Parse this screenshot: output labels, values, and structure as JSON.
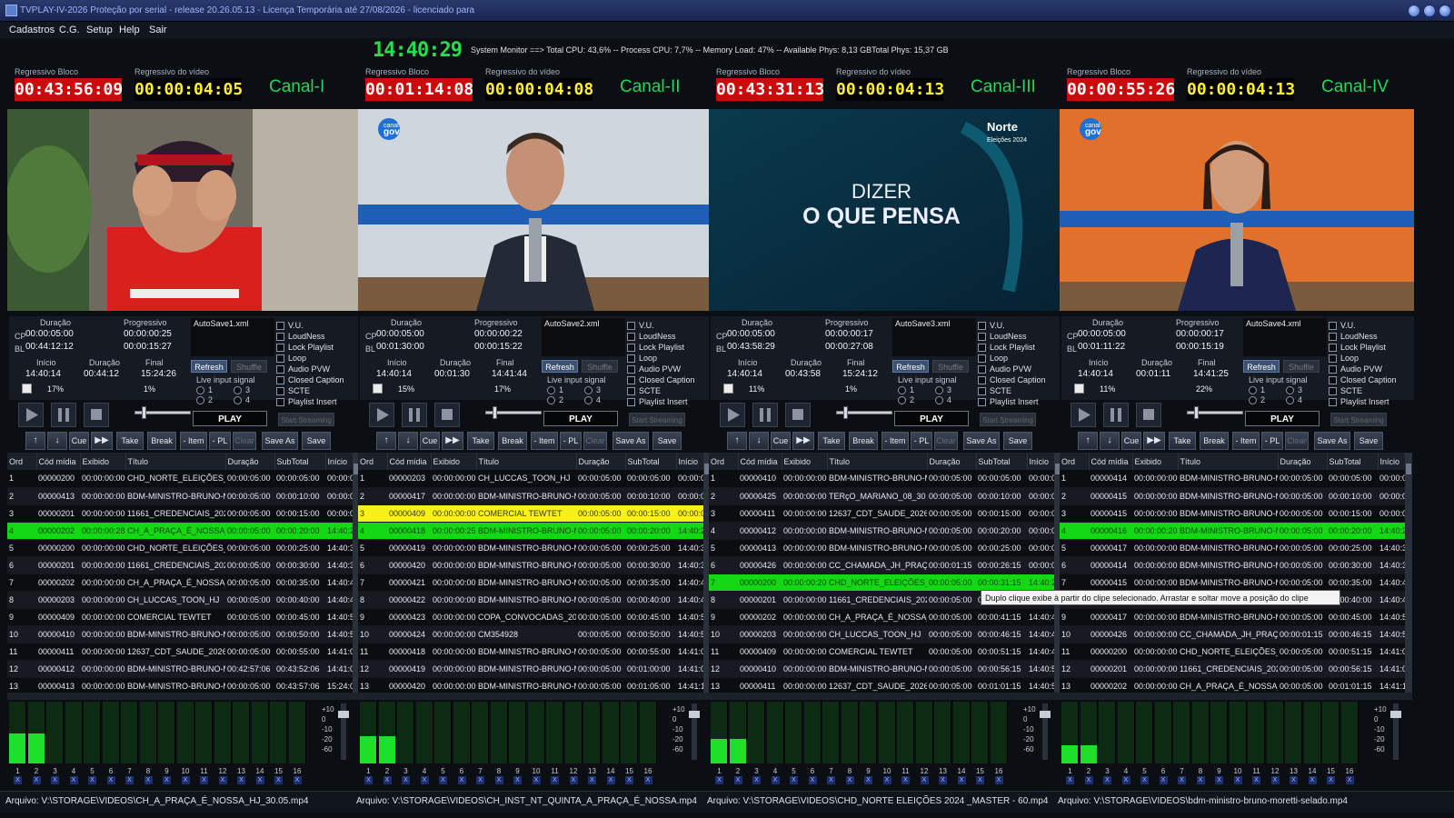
{
  "window": {
    "title": "TVPLAY-IV-2026  Proteção por serial   -  release 20.26.05.13 - Licença  Temporária até 27/08/2026 - licenciado para"
  },
  "menu": [
    "Cadastros",
    "C.G.",
    "Setup",
    "Help",
    "Sair"
  ],
  "clock": "14:40:29",
  "system_monitor": "System Monitor ==> Total CPU: 43,6% -- Process CPU: 7,7% -- Memory Load: 47% -- Available Phys: 8,13 GBTotal  Phys: 15,37 GB",
  "labels": {
    "reg_bloco": "Regressivo Bloco",
    "reg_video": "Regressivo do vídeo",
    "duracao": "Duração",
    "progressivo": "Progressivo",
    "inicio": "Início",
    "final": "Final",
    "cp": "CP",
    "bl": "BL",
    "live": "Live input signal",
    "refresh": "Refresh",
    "shuffle": "Shuffle",
    "play": "PLAY",
    "stream": "Start Streaming"
  },
  "checkboxes": [
    "V.U.",
    "LoudNess",
    "Lock Playlist",
    "Loop",
    "Audio PVW",
    "Closed Caption",
    "SCTE",
    "Playlist Insert"
  ],
  "radios": [
    "1",
    "3",
    "2",
    "4"
  ],
  "buttons": {
    "cue": "Cue",
    "take": "Take",
    "break": "Break",
    "item": "- Item",
    "pl": "- PL",
    "clear": "Clear",
    "saveas": "Save As",
    "save": "Save"
  },
  "table_headers": [
    "Ord",
    "Cód mídia",
    "Exibido",
    "Título",
    "Duração",
    "SubTotal",
    "Início"
  ],
  "meters": {
    "db": [
      "+10",
      "0",
      "-10",
      "-20",
      "-60"
    ],
    "numbers": [
      "1",
      "2",
      "3",
      "4",
      "5",
      "6",
      "7",
      "8",
      "9",
      "10",
      "11",
      "12",
      "13",
      "14",
      "15",
      "16"
    ],
    "mute": "X"
  },
  "tooltip": "Duplo clique exibe à partir do clipe selecionado. Arrastar e soltar move a posição do clipe",
  "preview3": {
    "line1": "DIZER",
    "line2": "O QUE PENSA",
    "logo": "Norte",
    "logo_sub": "Eleições 2024"
  },
  "preview_logo": "gov",
  "preview_logo_small": "canal",
  "channels": [
    {
      "name": "Canal-I",
      "reg_bloco": "00:43:56:09",
      "reg_video": "00:00:04:05",
      "cp_dur": "00:00:05:00",
      "bl_dur": "00:44:12:12",
      "cp_prog": "00:00:00:25",
      "bl_prog": "00:00:15:27",
      "inicio": "14:40:14",
      "duracao": "00:44:12",
      "final": "15:24:26",
      "pct1": "17%",
      "pct2": "1%",
      "file": "AutoSave1.xml",
      "arquivo": "Arquivo: V:\\STORAGE\\VIDEOS\\CH_A_PRAÇA_É_NOSSA_HJ_30.05.mp4",
      "meter": [
        0.48,
        0.48,
        0,
        0,
        0,
        0,
        0,
        0,
        0,
        0,
        0,
        0,
        0,
        0,
        0,
        0
      ],
      "rows": [
        [
          "1",
          "00000200",
          "00:00:00:00",
          "CHD_NORTE_ELEIÇÕES_2024",
          "00:00:05:00",
          "00:00:05:00",
          "00:00:0"
        ],
        [
          "2",
          "00000413",
          "00:00:00:00",
          "BDM-MINISTRO-BRUNO-MORETTI",
          "00:00:05:00",
          "00:00:10:00",
          "00:00:0"
        ],
        [
          "3",
          "00000201",
          "00:00:00:00",
          "11661_CREDENCIAIS_2026",
          "00:00:05:00",
          "00:00:15:00",
          "00:00:0"
        ],
        [
          "4",
          "00000202",
          "00:00:00:28",
          "CH_A_PRAÇA_É_NOSSA_HJ",
          "00:00:05:00",
          "00:00:20:00",
          "14:40:2"
        ],
        [
          "5",
          "00000200",
          "00:00:00:00",
          "CHD_NORTE_ELEIÇÕES_2024",
          "00:00:05:00",
          "00:00:25:00",
          "14:40:3"
        ],
        [
          "6",
          "00000201",
          "00:00:00:00",
          "11661_CREDENCIAIS_2026",
          "00:00:05:00",
          "00:00:30:00",
          "14:40:3"
        ],
        [
          "7",
          "00000202",
          "00:00:00:00",
          "CH_A_PRAÇA_É_NOSSA_HJ",
          "00:00:05:00",
          "00:00:35:00",
          "14:40:4"
        ],
        [
          "8",
          "00000203",
          "00:00:00:00",
          "CH_LUCCAS_TOON_HJ",
          "00:00:05:00",
          "00:00:40:00",
          "14:40:4"
        ],
        [
          "9",
          "00000409",
          "00:00:00:00",
          "COMERCIAL TEWTET",
          "00:00:05:00",
          "00:00:45:00",
          "14:40:5"
        ],
        [
          "10",
          "00000410",
          "00:00:00:00",
          "BDM-MINISTRO-BRUNO-MORETTI",
          "00:00:05:00",
          "00:00:50:00",
          "14:40:5"
        ],
        [
          "11",
          "00000411",
          "00:00:00:00",
          "12637_CDT_SAUDE_2026",
          "00:00:05:00",
          "00:00:55:00",
          "14:41:0"
        ],
        [
          "12",
          "00000412",
          "00:00:00:00",
          "BDM-MINISTRO-BRUNO-MORETTI",
          "00:42:57:06",
          "00:43:52:06",
          "14:41:0"
        ],
        [
          "13",
          "00000413",
          "00:00:00:00",
          "BDM-MINISTRO-BRUNO-MORETTI",
          "00:00:05:00",
          "00:43:57:06",
          "15:24:0"
        ]
      ]
    },
    {
      "name": "Canal-II",
      "reg_bloco": "00:01:14:08",
      "reg_video": "00:00:04:08",
      "cp_dur": "00:00:05:00",
      "bl_dur": "00:01:30:00",
      "cp_prog": "00:00:00:22",
      "bl_prog": "00:00:15:22",
      "inicio": "14:40:14",
      "duracao": "00:01:30",
      "final": "14:41:44",
      "pct1": "15%",
      "pct2": "17%",
      "file": "AutoSave2.xml",
      "arquivo": "Arquivo: V:\\STORAGE\\VIDEOS\\CH_INST_NT_QUINTA_A_PRAÇA_É_NOSSA.mp4",
      "meter": [
        0.44,
        0.44,
        0,
        0,
        0,
        0,
        0,
        0,
        0,
        0,
        0,
        0,
        0,
        0,
        0,
        0
      ],
      "rows": [
        [
          "1",
          "00000203",
          "00:00:00:00",
          "CH_LUCCAS_TOON_HJ",
          "00:00:05:00",
          "00:00:05:00",
          "00:00:0"
        ],
        [
          "2",
          "00000417",
          "00:00:00:00",
          "BDM-MINISTRO-BRUNO-MORETTI",
          "00:00:05:00",
          "00:00:10:00",
          "00:00:0"
        ],
        [
          "3",
          "00000409",
          "00:00:00:00",
          "COMERCIAL TEWTET",
          "00:00:05:00",
          "00:00:15:00",
          "00:00:0"
        ],
        [
          "4",
          "00000418",
          "00:00:00:25",
          "BDM-MINISTRO-BRUNO-MORETTI",
          "00:00:05:00",
          "00:00:20:00",
          "14:40:2"
        ],
        [
          "5",
          "00000419",
          "00:00:00:00",
          "BDM-MINISTRO-BRUNO-MORETTI",
          "00:00:05:00",
          "00:00:25:00",
          "14:40:3"
        ],
        [
          "6",
          "00000420",
          "00:00:00:00",
          "BDM-MINISTRO-BRUNO-MORETTI",
          "00:00:05:00",
          "00:00:30:00",
          "14:40:3"
        ],
        [
          "7",
          "00000421",
          "00:00:00:00",
          "BDM-MINISTRO-BRUNO-MORETTI",
          "00:00:05:00",
          "00:00:35:00",
          "14:40:4"
        ],
        [
          "8",
          "00000422",
          "00:00:00:00",
          "BDM-MINISTRO-BRUNO-MORETTI",
          "00:00:05:00",
          "00:00:40:00",
          "14:40:4"
        ],
        [
          "9",
          "00000423",
          "00:00:00:00",
          "COPA_CONVOCADAS_2026",
          "00:00:05:00",
          "00:00:45:00",
          "14:40:5"
        ],
        [
          "10",
          "00000424",
          "00:00:00:00",
          "CM354928",
          "00:00:05:00",
          "00:00:50:00",
          "14:40:5"
        ],
        [
          "11",
          "00000418",
          "00:00:00:00",
          "BDM-MINISTRO-BRUNO-MORETTI",
          "00:00:05:00",
          "00:00:55:00",
          "14:41:0"
        ],
        [
          "12",
          "00000419",
          "00:00:00:00",
          "BDM-MINISTRO-BRUNO-MORETTI",
          "00:00:05:00",
          "00:01:00:00",
          "14:41:0"
        ],
        [
          "13",
          "00000420",
          "00:00:00:00",
          "BDM-MINISTRO-BRUNO-MORETTI",
          "00:00:05:00",
          "00:01:05:00",
          "14:41:1"
        ]
      ]
    },
    {
      "name": "Canal-III",
      "reg_bloco": "00:43:31:13",
      "reg_video": "00:00:04:13",
      "cp_dur": "00:00:05:00",
      "bl_dur": "00:43:58:29",
      "cp_prog": "00:00:00:17",
      "bl_prog": "00:00:27:08",
      "inicio": "14:40:14",
      "duracao": "00:43:58",
      "final": "15:24:12",
      "pct1": "11%",
      "pct2": "1%",
      "file": "AutoSave3.xml",
      "arquivo": "Arquivo: V:\\STORAGE\\VIDEOS\\CHD_NORTE ELEIÇÕES 2024 _MASTER - 60.mp4",
      "meter": [
        0.4,
        0.4,
        0,
        0,
        0,
        0,
        0,
        0,
        0,
        0,
        0,
        0,
        0,
        0,
        0,
        0
      ],
      "rows": [
        [
          "1",
          "00000410",
          "00:00:00:00",
          "BDM-MINISTRO-BRUNO-MORETTI",
          "00:00:05:00",
          "00:00:05:00",
          "00:00:0"
        ],
        [
          "2",
          "00000425",
          "00:00:00:00",
          "TERçO_MARIANO_08_30",
          "00:00:05:00",
          "00:00:10:00",
          "00:00:0"
        ],
        [
          "3",
          "00000411",
          "00:00:00:00",
          "12637_CDT_SAUDE_2026",
          "00:00:05:00",
          "00:00:15:00",
          "00:00:0"
        ],
        [
          "4",
          "00000412",
          "00:00:00:00",
          "BDM-MINISTRO-BRUNO-MORETTI",
          "00:00:05:00",
          "00:00:20:00",
          "00:00:0"
        ],
        [
          "5",
          "00000413",
          "00:00:00:00",
          "BDM-MINISTRO-BRUNO-MORETTI",
          "00:00:05:00",
          "00:00:25:00",
          "00:00:0"
        ],
        [
          "6",
          "00000426",
          "00:00:00:00",
          "CC_CHAMADA_JH_PRAÇA",
          "00:00:01:15",
          "00:00:26:15",
          "00:00:0"
        ],
        [
          "7",
          "00000200",
          "00:00:00:20",
          "CHD_NORTE_ELEIÇÕES_2024",
          "00:00:05:00",
          "00:00:31:15",
          "14:40:2"
        ],
        [
          "8",
          "00000201",
          "00:00:00:00",
          "11661_CREDENCIAIS_2026",
          "00:00:05:00",
          "00:00:36:15",
          "14:40:3"
        ],
        [
          "9",
          "00000202",
          "00:00:00:00",
          "CH_A_PRAÇA_É_NOSSA_HJ",
          "00:00:05:00",
          "00:00:41:15",
          "14:40:4"
        ],
        [
          "10",
          "00000203",
          "00:00:00:00",
          "CH_LUCCAS_TOON_HJ",
          "00:00:05:00",
          "00:00:46:15",
          "14:40:4"
        ],
        [
          "11",
          "00000409",
          "00:00:00:00",
          "COMERCIAL TEWTET",
          "00:00:05:00",
          "00:00:51:15",
          "14:40:4"
        ],
        [
          "12",
          "00000410",
          "00:00:00:00",
          "BDM-MINISTRO-BRUNO-MORETTI",
          "00:00:05:00",
          "00:00:56:15",
          "14:40:5"
        ],
        [
          "13",
          "00000411",
          "00:00:00:00",
          "12637_CDT_SAUDE_2026",
          "00:00:05:00",
          "00:01:01:15",
          "14:40:5"
        ]
      ]
    },
    {
      "name": "Canal-IV",
      "reg_bloco": "00:00:55:26",
      "reg_video": "00:00:04:13",
      "cp_dur": "00:00:05:00",
      "bl_dur": "00:01:11:22",
      "cp_prog": "00:00:00:17",
      "bl_prog": "00:00:15:19",
      "inicio": "14:40:14",
      "duracao": "00:01:11",
      "final": "14:41:25",
      "pct1": "11%",
      "pct2": "22%",
      "file": "AutoSave4.xml",
      "arquivo": "Arquivo: V:\\STORAGE\\VIDEOS\\bdm-ministro-bruno-moretti-selado.mp4",
      "meter": [
        0.3,
        0.3,
        0,
        0,
        0,
        0,
        0,
        0,
        0,
        0,
        0,
        0,
        0,
        0,
        0,
        0
      ],
      "rows": [
        [
          "1",
          "00000414",
          "00:00:00:00",
          "BDM-MINISTRO-BRUNO-MORETTI",
          "00:00:05:00",
          "00:00:05:00",
          "00:00:0"
        ],
        [
          "2",
          "00000415",
          "00:00:00:00",
          "BDM-MINISTRO-BRUNO-MORETTI",
          "00:00:05:00",
          "00:00:10:00",
          "00:00:0"
        ],
        [
          "3",
          "00000415",
          "00:00:00:00",
          "BDM-MINISTRO-BRUNO-MORETTI",
          "00:00:05:00",
          "00:00:15:00",
          "00:00:0"
        ],
        [
          "4",
          "00000416",
          "00:00:00:20",
          "BDM-MINISTRO-BRUNO-MORETTI",
          "00:00:05:00",
          "00:00:20:00",
          "14:40:2"
        ],
        [
          "5",
          "00000417",
          "00:00:00:00",
          "BDM-MINISTRO-BRUNO-MORETTI",
          "00:00:05:00",
          "00:00:25:00",
          "14:40:3"
        ],
        [
          "6",
          "00000414",
          "00:00:00:00",
          "BDM-MINISTRO-BRUNO-MORETTI",
          "00:00:05:00",
          "00:00:30:00",
          "14:40:3"
        ],
        [
          "7",
          "00000415",
          "00:00:00:00",
          "BDM-MINISTRO-BRUNO-MORETTI",
          "00:00:05:00",
          "00:00:35:00",
          "14:40:4"
        ],
        [
          "8",
          "00000416",
          "00:00:00:00",
          "BDM-MINISTRO-BRUNO-MORETTI",
          "00:00:05:00",
          "00:00:40:00",
          "14:40:4"
        ],
        [
          "9",
          "00000417",
          "00:00:00:00",
          "BDM-MINISTRO-BRUNO-MORETTI",
          "00:00:05:00",
          "00:00:45:00",
          "14:40:5"
        ],
        [
          "10",
          "00000426",
          "00:00:00:00",
          "CC_CHAMADA_JH_PRAÇA",
          "00:00:01:15",
          "00:00:46:15",
          "14:40:5"
        ],
        [
          "11",
          "00000200",
          "00:00:00:00",
          "CHD_NORTE_ELEIÇÕES_2024",
          "00:00:05:00",
          "00:00:51:15",
          "14:41:0"
        ],
        [
          "12",
          "00000201",
          "00:00:00:00",
          "11661_CREDENCIAIS_2026",
          "00:00:05:00",
          "00:00:56:15",
          "14:41:0"
        ],
        [
          "13",
          "00000202",
          "00:00:00:00",
          "CH_A_PRAÇA_É_NOSSA_HJ",
          "00:00:05:00",
          "00:01:01:15",
          "14:41:1"
        ]
      ]
    }
  ],
  "highlights": [
    {
      "row": 3,
      "cls": "hl-green"
    },
    {
      "row": 2,
      "cls": "hl-yellow",
      "row2": 3,
      "cls2": "hl-green"
    },
    {
      "row": 6,
      "cls": "hl-green"
    },
    {
      "row": 3,
      "cls": "hl-green"
    }
  ],
  "colors": {
    "accent_green": "#20d85a",
    "counter_red": "#cc0a0a",
    "counter_yellow": "#ffee35",
    "onair_green": "#14d814",
    "next_yellow": "#f4f21a"
  }
}
